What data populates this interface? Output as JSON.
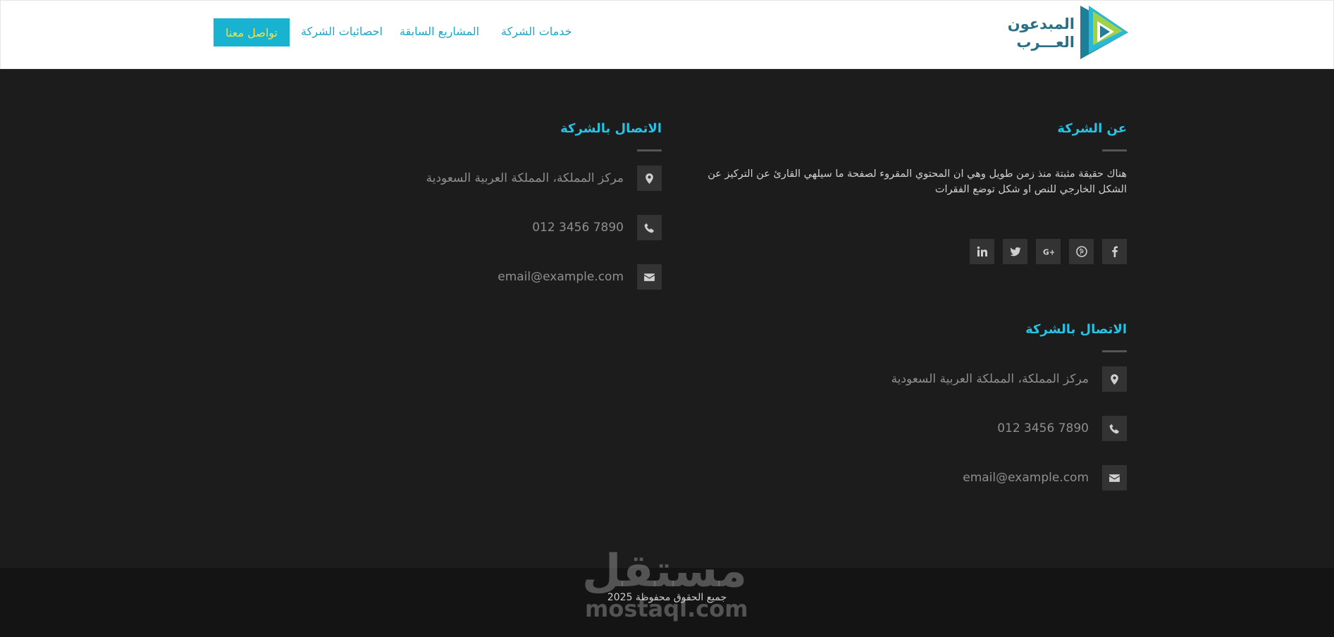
{
  "logo": {
    "line1": "المبدعون",
    "line2": "العـــرب"
  },
  "nav": {
    "services": "خدمات الشركة",
    "projects": "المشاريع السابقة",
    "stats": "احصائيات الشركة",
    "contact_cta": "تواصل معنا"
  },
  "about": {
    "title": "عن الشركة",
    "text": "هناك حقيقة مثبتة منذ زمن طويل وهي ان المحتوي المقروء لصفحة ما سيلهي القارئ عن التركيز عن الشكل الخارجي للنص او شكل توضع الفقرات"
  },
  "social_icons": [
    "facebook-icon",
    "pinterest-icon",
    "google-plus-icon",
    "twitter-icon",
    "linkedin-icon"
  ],
  "contact_top": {
    "title": "الاتصال بالشركة",
    "address": "مركز المملكة، المملكة العربية السعودية",
    "phone": "012 3456 7890",
    "email": "email@example.com"
  },
  "contact_bottom": {
    "title": "الاتصال بالشركة",
    "address": "مركز المملكة، المملكة العربية السعودية",
    "phone": "012 3456 7890",
    "email": "email@example.com"
  },
  "footer": {
    "copyright": "جميع الحقوق محفوظة 2025"
  },
  "watermark": {
    "arabic": "مستقل",
    "latin": "mostaql.com"
  },
  "colors": {
    "accent": "#17b3d1",
    "heading": "#25c4e6",
    "cta_text": "#f2e34a",
    "bg": "#1c1c1c"
  }
}
